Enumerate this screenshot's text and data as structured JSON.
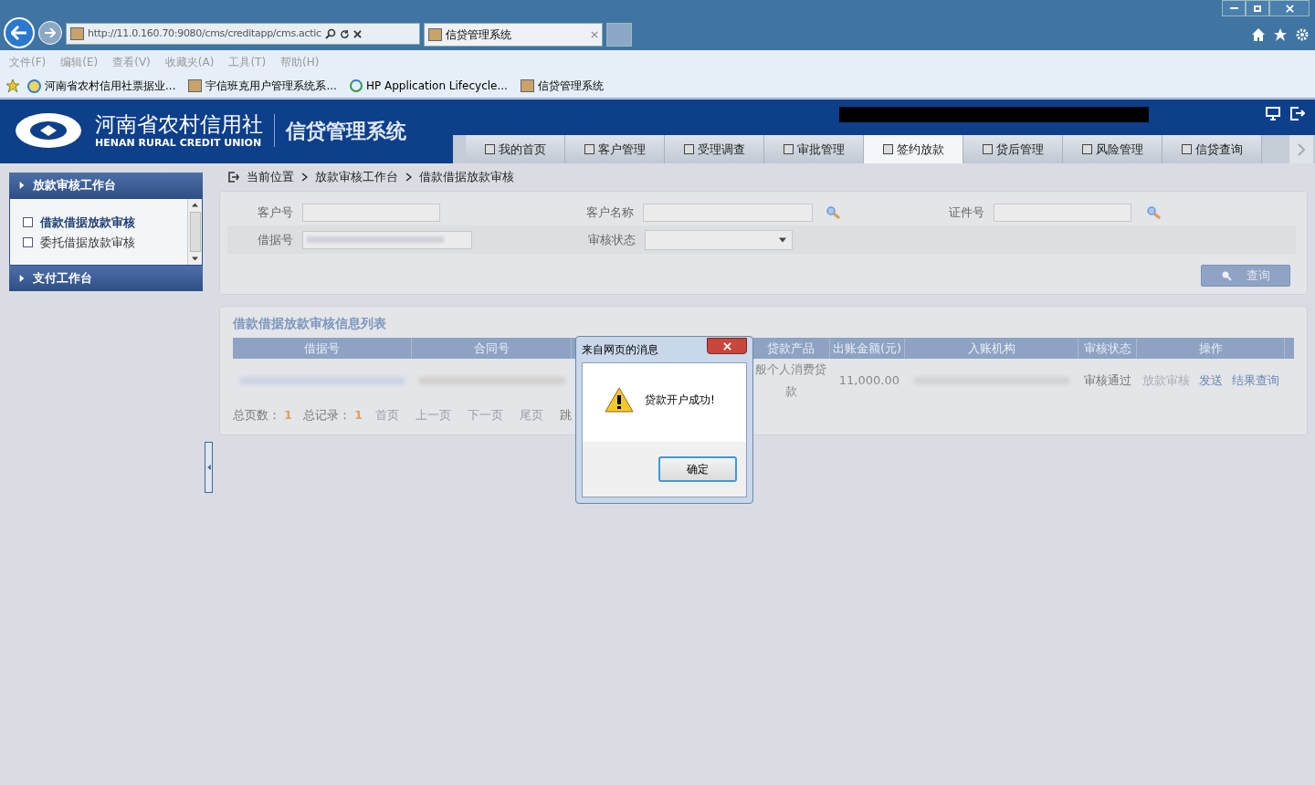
{
  "browser": {
    "address": "http://11.0.160.70:9080/cms/creditapp/cms.actic",
    "tab_title": "信贷管理系统",
    "menu": [
      "文件(F)",
      "编辑(E)",
      "查看(V)",
      "收藏夹(A)",
      "工具(T)",
      "帮助(H)"
    ],
    "favorites": [
      {
        "label": "河南省农村信用社票据业...",
        "kind": "ie"
      },
      {
        "label": "宇信班克用户管理系统系...",
        "kind": "page"
      },
      {
        "label": "HP Application Lifecycle...",
        "kind": "hp"
      },
      {
        "label": "信贷管理系统",
        "kind": "page"
      }
    ]
  },
  "header": {
    "logo_cn": "河南省农村信用社",
    "logo_en": "HENAN RURAL CREDIT UNION",
    "system_name": "信贷管理系统",
    "tabs": [
      {
        "label": "我的首页",
        "selected": false
      },
      {
        "label": "客户管理",
        "selected": false
      },
      {
        "label": "受理调查",
        "selected": false
      },
      {
        "label": "审批管理",
        "selected": false
      },
      {
        "label": "签约放款",
        "selected": true
      },
      {
        "label": "贷后管理",
        "selected": false
      },
      {
        "label": "风险管理",
        "selected": false
      },
      {
        "label": "信贷查询",
        "selected": false
      }
    ]
  },
  "sidebar": [
    {
      "title": "放款审核工作台",
      "expanded": true,
      "items": [
        {
          "label": "借款借据放款审核",
          "selected": true
        },
        {
          "label": "委托借据放款审核",
          "selected": false
        }
      ]
    },
    {
      "title": "支付工作台",
      "expanded": false
    }
  ],
  "breadcrumb": [
    "当前位置",
    "放款审核工作台",
    "借款借据放款审核"
  ],
  "search_form": {
    "customer_no": "客户号",
    "customer_name": "客户名称",
    "id_no": "证件号",
    "loan_no": "借据号",
    "status": "审核状态",
    "query_button": "查询"
  },
  "list": {
    "title": "借款借据放款审核信息列表",
    "columns": [
      "借据号",
      "合同号",
      "",
      "贷款产品",
      "出账金额(元)",
      "入账机构",
      "审核状态",
      "操作"
    ],
    "rows": [
      {
        "product": "般个人消费贷款",
        "amount": "11,000.00",
        "status": "审核通过",
        "actions": [
          {
            "label": "放款审核",
            "disabled": true
          },
          {
            "label": "发送",
            "disabled": false
          },
          {
            "label": "结果查询",
            "disabled": false
          }
        ]
      }
    ],
    "pager": {
      "pages_label": "总页数：",
      "pages": "1",
      "records_label": "总记录：",
      "records": "1",
      "links": [
        "首页",
        "上一页",
        "下一页",
        "尾页"
      ],
      "jump": "跳"
    }
  },
  "dialog": {
    "title": "来自网页的消息",
    "message": "贷款开户成功!",
    "ok": "确定"
  }
}
